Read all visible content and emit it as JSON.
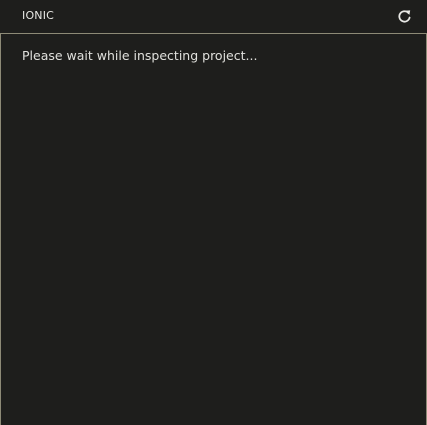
{
  "header": {
    "title": "IONIC",
    "refresh_icon": "refresh-icon"
  },
  "main": {
    "message": "Please wait while inspecting project..."
  },
  "colors": {
    "background": "#1e1e1c",
    "border": "#8d8a76",
    "text": "#e0e0dc"
  }
}
